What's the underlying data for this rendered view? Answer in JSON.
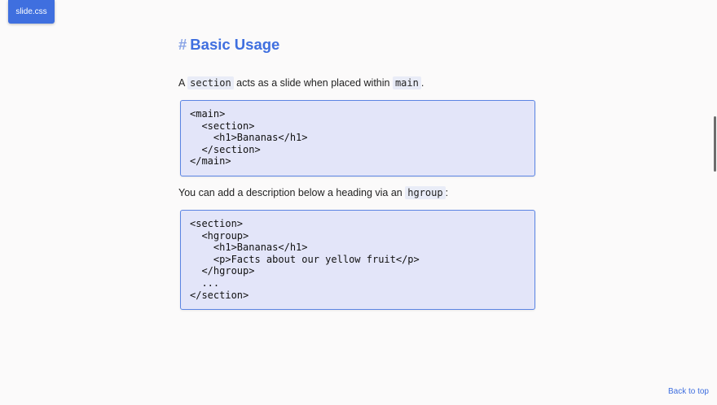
{
  "brand": {
    "label": "slide.css"
  },
  "section": {
    "hash": "#",
    "title": "Basic Usage",
    "para1": {
      "pre": "A ",
      "code1": "section",
      "mid": " acts as a slide when placed within ",
      "code2": "main",
      "post": "."
    },
    "code1": "<main>\n  <section>\n    <h1>Bananas</h1>\n  </section>\n</main>",
    "para2": {
      "pre": "You can add a description below a heading via an ",
      "code": "hgroup",
      "post": ":"
    },
    "code2": "<section>\n  <hgroup>\n    <h1>Bananas</h1>\n    <p>Facts about our yellow fruit</p>\n  </hgroup>\n  ...\n</section>"
  },
  "footer": {
    "back_to_top": "Back to top"
  }
}
